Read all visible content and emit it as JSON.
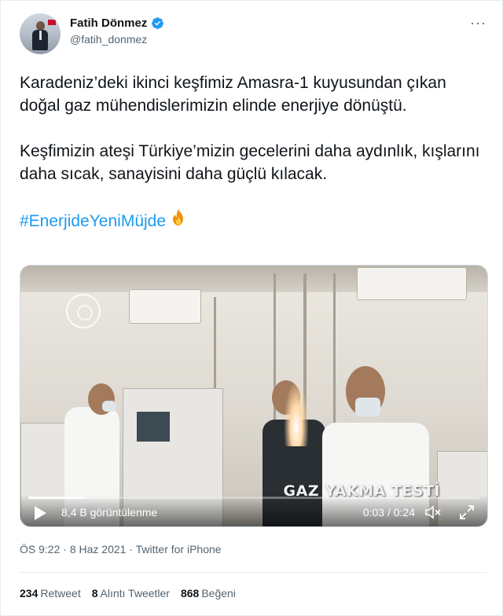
{
  "author": {
    "display_name": "Fatih Dönmez",
    "handle": "@fatih_donmez",
    "verified": true
  },
  "tweet": {
    "paragraph_1": "Karadeniz’deki ikinci keşfimiz Amasra-1 kuyusundan çıkan doğal gaz mühendislerimizin elinde enerjiye dönüştü.",
    "paragraph_2": "Keşfimizin ateşi Türkiye’mizin gecelerini daha aydınlık, kışlarını daha sıcak, sanayisini daha güçlü kılacak.",
    "hashtag": "#EnerjideYeniMüjde",
    "emoji": "fire-emoji"
  },
  "video": {
    "overlay_caption": "GAZ YAKMA TESTİ",
    "views_label": "8,4 B görüntülenme",
    "time_label": "0:03 / 0:24",
    "progress": 0.125
  },
  "meta": {
    "time": "ÖS 9:22",
    "date": "8 Haz 2021",
    "source": "Twitter for iPhone"
  },
  "stats": {
    "retweet_count": "234",
    "retweet_label": "Retweet",
    "quote_count": "8",
    "quote_label": "Alıntı Tweetler",
    "like_count": "868",
    "like_label": "Beğeni"
  },
  "colors": {
    "link": "#1d9bf0",
    "secondary_text": "#536471",
    "primary_text": "#0f1419"
  }
}
